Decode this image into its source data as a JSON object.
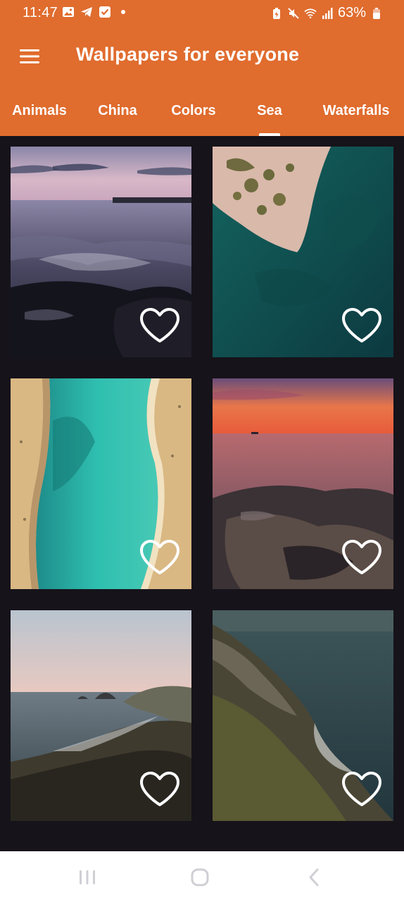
{
  "status_bar": {
    "time": "11:47",
    "battery_percent": "63%",
    "left_icons": [
      "gallery-icon",
      "telegram-icon",
      "check-square-icon",
      "dot-icon"
    ],
    "right_icons": [
      "battery-saver-icon",
      "mute-icon",
      "wifi-icon",
      "signal-icon",
      "battery-icon"
    ]
  },
  "toolbar": {
    "title": "Wallpapers for everyone",
    "menu_icon": "hamburger-menu-icon"
  },
  "tabs": [
    {
      "label": "Animals",
      "selected": false
    },
    {
      "label": "China",
      "selected": false
    },
    {
      "label": "Colors",
      "selected": false
    },
    {
      "label": "Sea",
      "selected": true
    },
    {
      "label": "Waterfalls",
      "selected": false
    }
  ],
  "wallpapers": [
    {
      "subject": "sea-sunset-rocks",
      "favorite": false,
      "icon": "heart-outline-icon"
    },
    {
      "subject": "aerial-coast-turquoise",
      "favorite": false,
      "icon": "heart-outline-icon"
    },
    {
      "subject": "aerial-beach-lagoon",
      "favorite": false,
      "icon": "heart-outline-icon"
    },
    {
      "subject": "sunset-rocky-shore",
      "favorite": false,
      "icon": "heart-outline-icon"
    },
    {
      "subject": "bay-rocks-dusk",
      "favorite": false,
      "icon": "heart-outline-icon"
    },
    {
      "subject": "cliff-coastline",
      "favorite": false,
      "icon": "heart-outline-icon"
    }
  ],
  "nav_bar": {
    "buttons": [
      "recents-icon",
      "home-icon",
      "back-icon"
    ]
  },
  "colors": {
    "accent": "#e06c2e",
    "background": "#16131a",
    "nav_background": "#ffffff"
  }
}
